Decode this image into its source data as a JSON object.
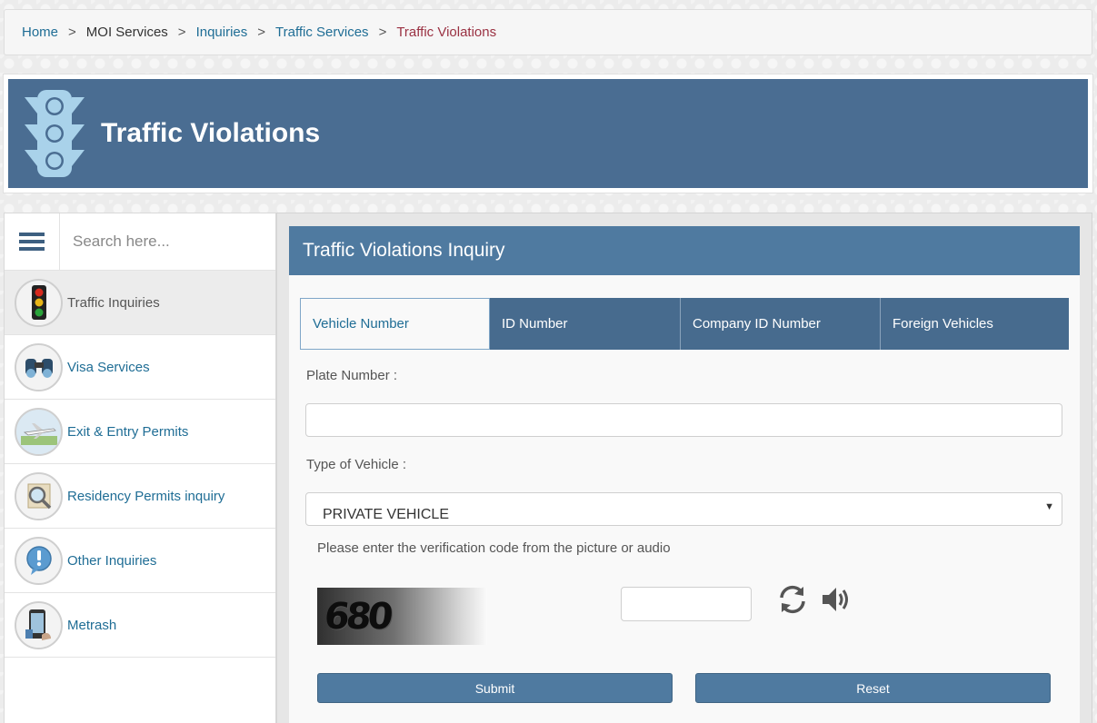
{
  "breadcrumb": {
    "items": [
      "Home",
      "MOI Services",
      "Inquiries",
      "Traffic Services",
      "Traffic Violations"
    ],
    "separator": ">"
  },
  "banner": {
    "title": "Traffic Violations",
    "icon": "traffic-light-icon"
  },
  "sidebar": {
    "search_placeholder": "Search here...",
    "items": [
      {
        "label": "Traffic Inquiries",
        "icon": "traffic-light-icon",
        "active": true
      },
      {
        "label": "Visa Services",
        "icon": "binoculars-icon"
      },
      {
        "label": "Exit & Entry Permits",
        "icon": "airplane-icon"
      },
      {
        "label": "Residency Permits inquiry",
        "icon": "magnifier-document-icon"
      },
      {
        "label": "Other Inquiries",
        "icon": "exclamation-icon"
      },
      {
        "label": "Metrash",
        "icon": "phone-icon"
      }
    ]
  },
  "main": {
    "header": "Traffic Violations Inquiry",
    "tabs": [
      {
        "label": "Vehicle Number",
        "active": true
      },
      {
        "label": "ID Number"
      },
      {
        "label": "Company ID Number"
      },
      {
        "label": "Foreign Vehicles"
      }
    ],
    "plate_label": "Plate Number :",
    "plate_value": "",
    "vehicle_type_label": "Type of Vehicle :",
    "vehicle_type_value": "PRIVATE VEHICLE",
    "verification_text": "Please enter the verification code from the picture or audio",
    "captcha_text": "680",
    "captcha_input": "",
    "submit_label": "Submit",
    "reset_label": "Reset"
  },
  "colors": {
    "banner": "#4a6d92",
    "panel_header": "#4f7aa0",
    "tabs": "#476b8e",
    "link": "#1f6d95",
    "current_crumb": "#9a3142"
  }
}
